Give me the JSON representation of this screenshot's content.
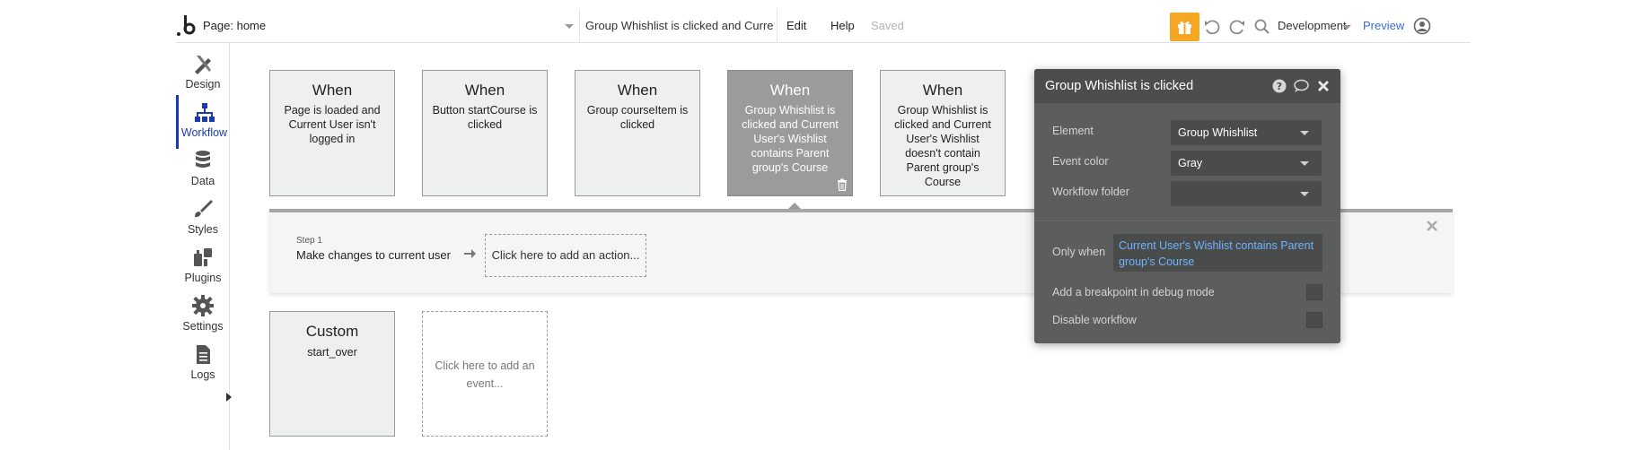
{
  "topbar": {
    "page_label": "Page: home",
    "workflow_label": "Group Whishlist is clicked and Curre...",
    "edit": "Edit",
    "help": "Help",
    "saved": "Saved",
    "environment": "Development",
    "preview": "Preview",
    "accent": "#f5a623"
  },
  "sidebar": {
    "items": [
      {
        "label": "Design",
        "icon": "design-icon"
      },
      {
        "label": "Workflow",
        "icon": "workflow-icon",
        "active": true
      },
      {
        "label": "Data",
        "icon": "database-icon"
      },
      {
        "label": "Styles",
        "icon": "brush-icon"
      },
      {
        "label": "Plugins",
        "icon": "plugins-icon"
      },
      {
        "label": "Settings",
        "icon": "gear-icon"
      },
      {
        "label": "Logs",
        "icon": "document-icon"
      }
    ],
    "active_color": "#1a39b8"
  },
  "events": [
    {
      "when": "When",
      "desc": "Page is loaded and Current User isn't logged in"
    },
    {
      "when": "When",
      "desc": "Button startCourse is clicked"
    },
    {
      "when": "When",
      "desc": "Group courseItem is clicked"
    },
    {
      "when": "When",
      "desc": "Group Whishlist is clicked and Current User's Wishlist contains Parent group's Course",
      "selected": true
    },
    {
      "when": "When",
      "desc": "Group Whishlist is clicked and Current User's Wishlist doesn't contain Parent group's Course"
    }
  ],
  "actions": {
    "step_label": "Step 1",
    "step_name": "Make changes to current user",
    "add_action": "Click here to add an action..."
  },
  "custom_events": [
    {
      "when": "Custom",
      "desc": "start_over"
    }
  ],
  "add_event": "Click here to add an event...",
  "panel": {
    "title": "Group Whishlist is clicked",
    "element_label": "Element",
    "element_value": "Group Whishlist",
    "color_label": "Event color",
    "color_value": "Gray",
    "folder_label": "Workflow folder",
    "folder_value": "",
    "only_when_label": "Only when",
    "only_when_value": "Current User's Wishlist contains Parent group's Course",
    "breakpoint_label": "Add a breakpoint in debug mode",
    "disable_label": "Disable workflow",
    "link_color": "#6fb3ff"
  }
}
